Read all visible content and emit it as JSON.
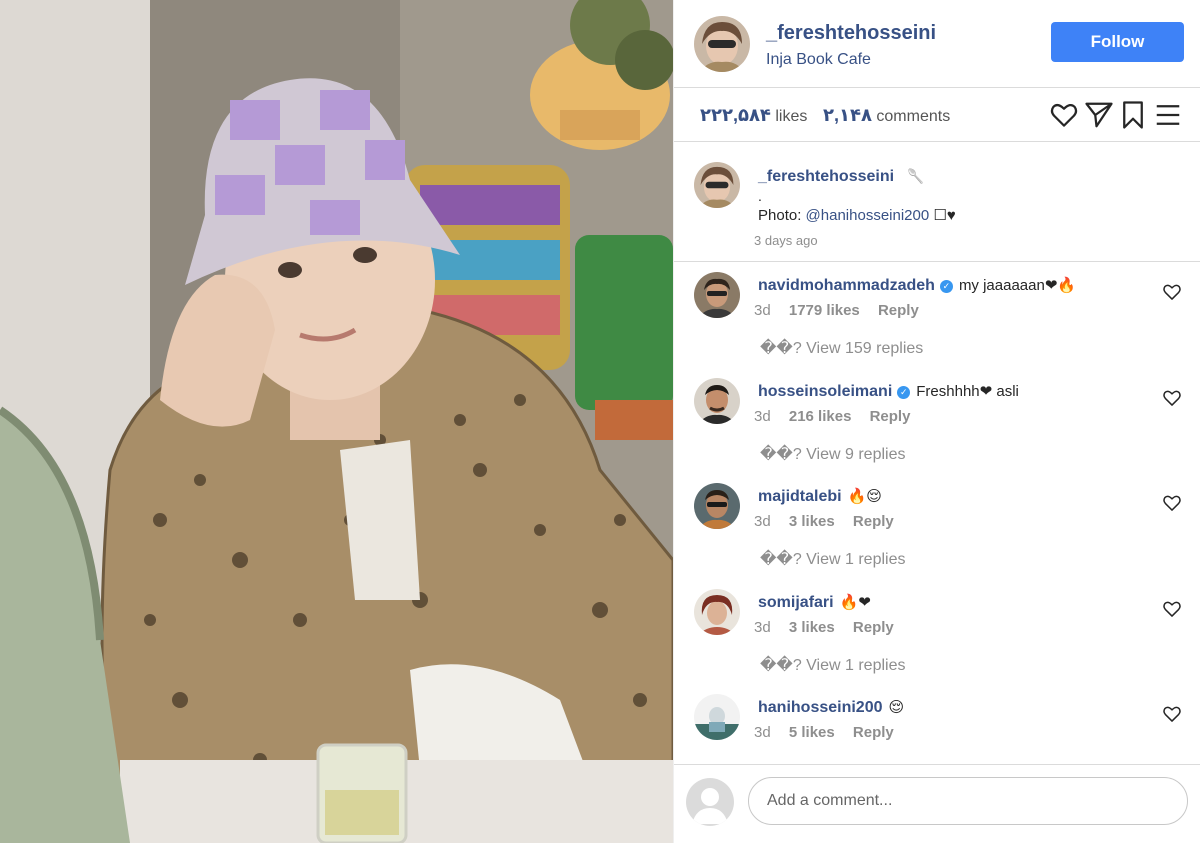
{
  "post": {
    "username": "_fereshtehosseini",
    "location": "Inja Book Cafe",
    "follow_label": "Follow"
  },
  "stats": {
    "likes_value": "۲۲۲,۵۸۴",
    "likes_label": "likes",
    "comments_value": "۲,۱۴۸",
    "comments_label": "comments"
  },
  "icons": {
    "like": "heart-icon",
    "share": "send-icon",
    "save": "bookmark-icon",
    "menu": "hamburger-menu-icon"
  },
  "caption": {
    "username": "_fereshtehosseini",
    "emoji": "🥄",
    "line1": ".",
    "photo_prefix": "Photo:",
    "mention": "@hanihosseini200",
    "suffix": "☐♥",
    "time": "3 days ago"
  },
  "comments": [
    {
      "username": "navidmohammadzadeh",
      "verified": true,
      "text": "my jaaaaaan❤🔥",
      "time": "3d",
      "likes": "1779 likes",
      "reply": "Reply",
      "view_replies": "��? View 159 replies"
    },
    {
      "username": "hosseinsoleimani",
      "verified": true,
      "text": "Freshhhh❤ asli",
      "time": "3d",
      "likes": "216 likes",
      "reply": "Reply",
      "view_replies": "��? View 9 replies"
    },
    {
      "username": "majidtalebi",
      "verified": false,
      "text": "🔥😌",
      "time": "3d",
      "likes": "3 likes",
      "reply": "Reply",
      "view_replies": "��? View 1 replies"
    },
    {
      "username": "somijafari",
      "verified": false,
      "text": "🔥❤",
      "time": "3d",
      "likes": "3 likes",
      "reply": "Reply",
      "view_replies": "��? View 1 replies"
    },
    {
      "username": "hanihosseini200",
      "verified": false,
      "text": "😌",
      "time": "3d",
      "likes": "5 likes",
      "reply": "Reply",
      "view_replies": ""
    }
  ],
  "add_comment": {
    "placeholder": "Add a comment..."
  },
  "colors": {
    "link": "#385185",
    "follow_button": "#3e82f7",
    "muted": "#8e8e8e",
    "divider": "#dbdbdb"
  }
}
